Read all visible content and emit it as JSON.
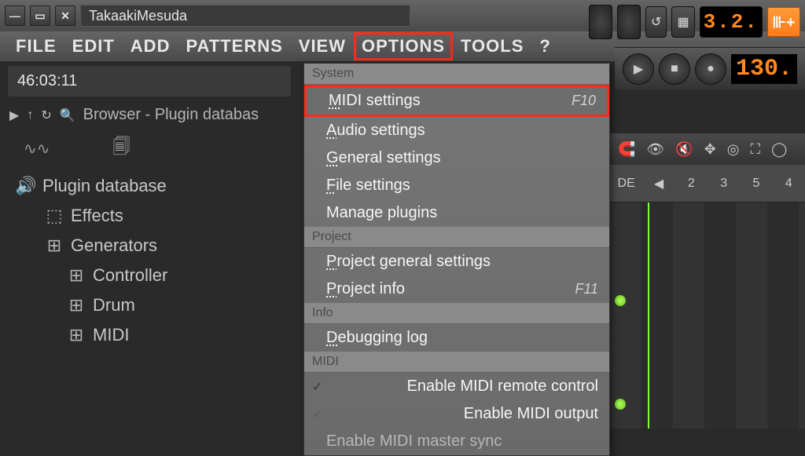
{
  "title": "TakaakiMesuda",
  "counter": "46:03:11",
  "menu": {
    "file": "FILE",
    "edit": "EDIT",
    "add": "ADD",
    "patterns": "PATTERNS",
    "view": "VIEW",
    "options": "OPTIONS",
    "tools": "TOOLS",
    "help": "?"
  },
  "browser_header": "Browser - Plugin databas",
  "tree": {
    "root": "Plugin database",
    "effects": "Effects",
    "generators": "Generators",
    "controller": "Controller",
    "drum": "Drum",
    "midi": "MIDI"
  },
  "dropdown": {
    "sections": {
      "system": "System",
      "project": "Project",
      "info": "Info",
      "midi": "MIDI"
    },
    "items": {
      "midi_settings": {
        "label": "MIDI settings",
        "shortcut": "F10"
      },
      "audio_settings": {
        "label": "Audio settings"
      },
      "general_settings": {
        "label": "General settings"
      },
      "file_settings": {
        "label": "File settings"
      },
      "manage_plugins": {
        "label": "Manage plugins"
      },
      "project_general": {
        "label": "Project general settings"
      },
      "project_info": {
        "label": "Project info",
        "shortcut": "F11"
      },
      "debugging_log": {
        "label": "Debugging log"
      },
      "enable_remote": {
        "label": "Enable MIDI remote control"
      },
      "enable_output": {
        "label": "Enable MIDI output"
      },
      "enable_master_sync": {
        "label": "Enable MIDI master sync"
      }
    }
  },
  "toolbar_right": {
    "pattern_num": "3.2.",
    "mode": "⊪+"
  },
  "transport": {
    "tempo": "130."
  },
  "timeline": {
    "mode": "DE",
    "marks": [
      "2",
      "3",
      "5",
      "4"
    ]
  }
}
